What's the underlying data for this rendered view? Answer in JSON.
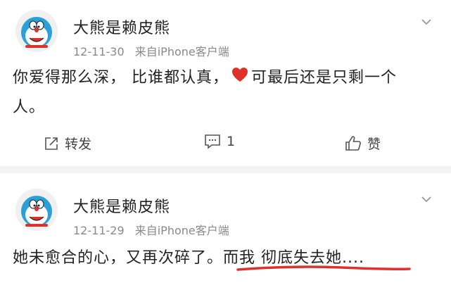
{
  "posts": [
    {
      "username": "大熊是赖皮熊",
      "date": "12-11-30",
      "source": "来自iPhone客户端",
      "text_before_heart": "你爱得那么深， 比谁都认真，",
      "text_after_heart": "可最后还是只剩一个人。",
      "actions": {
        "repost_label": "转发",
        "comment_count": "1",
        "like_label": "赞"
      }
    },
    {
      "username": "大熊是赖皮熊",
      "date": "12-11-29",
      "source": "来自iPhone客户端",
      "text": "她未愈合的心，又再次碎了。而我 彻底失去她...."
    }
  ],
  "colors": {
    "heart": "#e0302a",
    "underline": "#e0302a",
    "meta": "#8a8a8a"
  }
}
